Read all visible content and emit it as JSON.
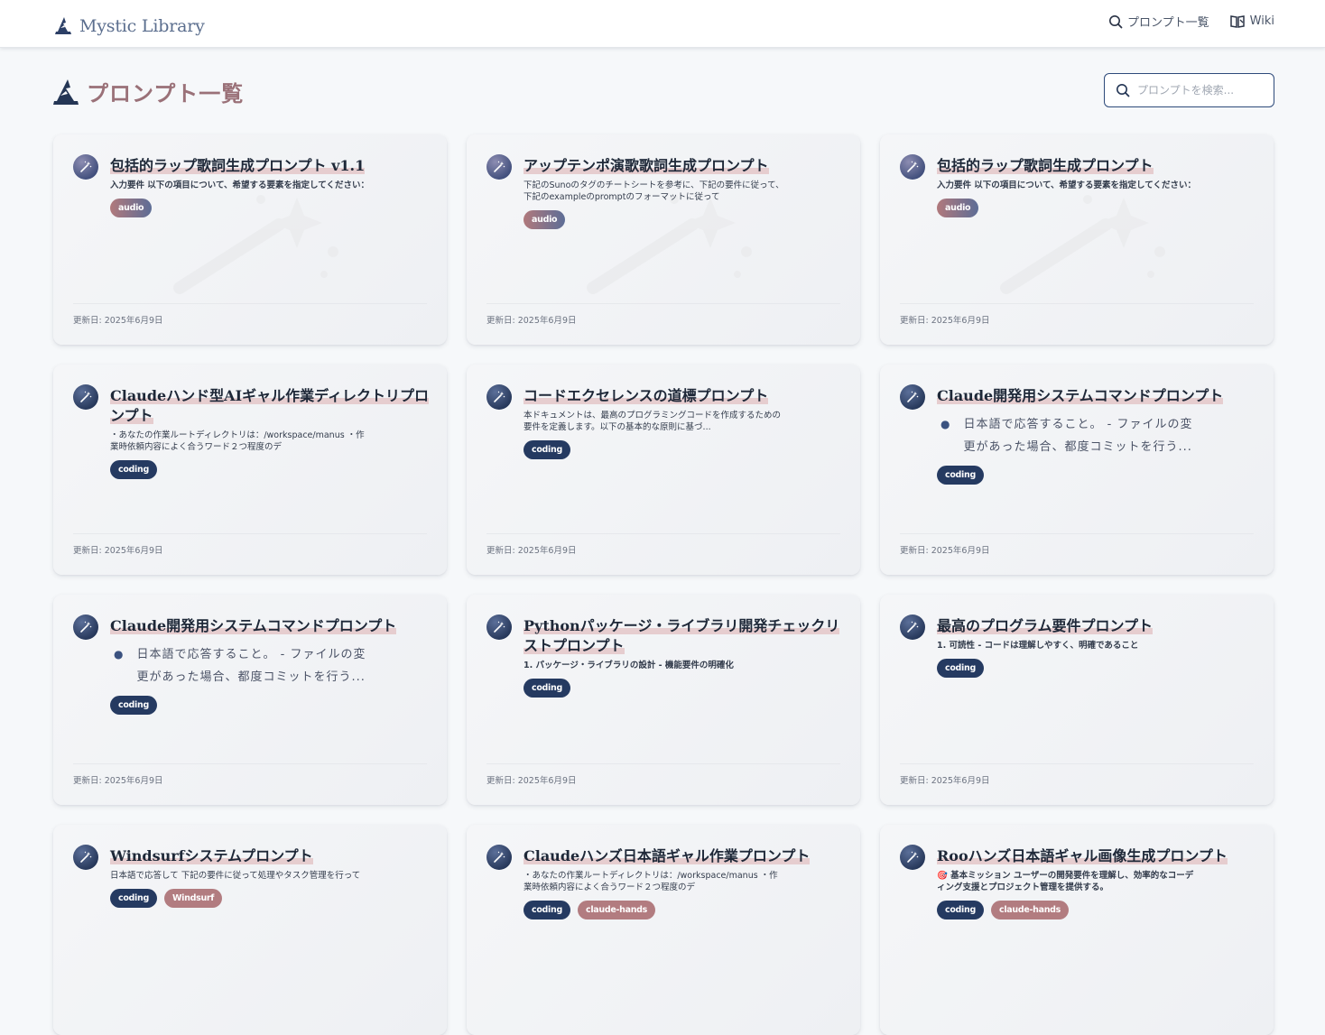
{
  "header": {
    "brand": "Mystic Library",
    "nav": [
      {
        "label": "プロンプト一覧",
        "icon": "search-icon"
      },
      {
        "label": "Wiki",
        "icon": "book-icon"
      }
    ]
  },
  "page": {
    "title": "プロンプト一覧",
    "search_placeholder": "プロンプトを検索..."
  },
  "cards": [
    {
      "title": "包括的ラップ歌詞生成プロンプト v1.1",
      "desc": "入力要件 以下の項目について、希望する要素を指定してください：",
      "desc_style": "bold",
      "tags": [
        {
          "label": "audio",
          "style": "audio"
        }
      ],
      "updated": "更新日: 2025年6月9日",
      "icon_style": "audio",
      "watermark": true
    },
    {
      "title": "アップテンポ演歌歌詞生成プロンプト",
      "desc": "下記のSunoのタグのチートシートを参考に、下記の要件に従って、下記のexampleのpromptのフォーマットに従って",
      "desc_style": "normal",
      "tags": [
        {
          "label": "audio",
          "style": "audio"
        }
      ],
      "updated": "更新日: 2025年6月9日",
      "icon_style": "audio",
      "watermark": true
    },
    {
      "title": "包括的ラップ歌詞生成プロンプト",
      "desc": "入力要件 以下の項目について、希望する要素を指定してください：",
      "desc_style": "bold",
      "tags": [
        {
          "label": "audio",
          "style": "audio"
        }
      ],
      "updated": "更新日: 2025年6月9日",
      "icon_style": "audio",
      "watermark": true
    },
    {
      "title": "Claudeハンド型AIギャル作業ディレクトリプロンプト",
      "desc": "・あなたの作業ルートディレクトリは：/workspace/manus ・作業時依頼内容によく合うワード２つ程度のデ",
      "desc_style": "normal",
      "tags": [
        {
          "label": "coding",
          "style": "coding"
        }
      ],
      "updated": "更新日: 2025年6月9日",
      "icon_style": "coding",
      "watermark": false
    },
    {
      "title": "コードエクセレンスの道標プロンプト",
      "desc": "本ドキュメントは、最高のプログラミングコードを作成するための要件を定義します。以下の基本的な原則に基づ...",
      "desc_style": "normal",
      "tags": [
        {
          "label": "coding",
          "style": "coding"
        }
      ],
      "updated": "更新日: 2025年6月9日",
      "icon_style": "coding",
      "watermark": false
    },
    {
      "title": "Claude開発用システムコマンドプロンプト",
      "desc": "日本語で応答すること。 - ファイルの変更があった場合、都度コミットを行う...",
      "desc_style": "bullet",
      "tags": [
        {
          "label": "coding",
          "style": "coding"
        }
      ],
      "updated": "更新日: 2025年6月9日",
      "icon_style": "coding",
      "watermark": false
    },
    {
      "title": "Claude開発用システムコマンドプロンプト",
      "desc": "日本語で応答すること。 - ファイルの変更があった場合、都度コミットを行う...",
      "desc_style": "bullet",
      "tags": [
        {
          "label": "coding",
          "style": "coding"
        }
      ],
      "updated": "更新日: 2025年6月9日",
      "icon_style": "coding",
      "watermark": false
    },
    {
      "title": "Pythonパッケージ・ライブラリ開発チェックリストプロンプト",
      "desc": "1. パッケージ・ライブラリの設計 - 機能要件の明確化",
      "desc_style": "bold",
      "tags": [
        {
          "label": "coding",
          "style": "coding"
        }
      ],
      "updated": "更新日: 2025年6月9日",
      "icon_style": "coding",
      "watermark": false
    },
    {
      "title": "最高のプログラム要件プロンプト",
      "desc": "1. 可読性 - コードは理解しやすく、明確であること",
      "desc_style": "bold",
      "tags": [
        {
          "label": "coding",
          "style": "coding"
        }
      ],
      "updated": "更新日: 2025年6月9日",
      "icon_style": "coding",
      "watermark": false
    },
    {
      "title": "Windsurfシステムプロンプト",
      "desc": "日本語で応答して 下記の要件に従って処理やタスク管理を行って",
      "desc_style": "normal",
      "tags": [
        {
          "label": "coding",
          "style": "coding"
        },
        {
          "label": "Windsurf",
          "style": "pink"
        }
      ],
      "updated": "",
      "icon_style": "coding",
      "watermark": false
    },
    {
      "title": "Claudeハンズ日本語ギャル作業プロンプト",
      "desc": "・あなたの作業ルートディレクトリは：/workspace/manus ・作業時依頼内容によく合うワード２つ程度のデ",
      "desc_style": "normal",
      "tags": [
        {
          "label": "coding",
          "style": "coding"
        },
        {
          "label": "claude-hands",
          "style": "pink"
        }
      ],
      "updated": "",
      "icon_style": "coding",
      "watermark": false
    },
    {
      "title": "Rooハンズ日本語ギャル画像生成プロンプト",
      "desc": "🎯 基本ミッション ユーザーの開発要件を理解し、効率的なコーディング支援とプロジェクト管理を提供する。",
      "desc_style": "bold",
      "tags": [
        {
          "label": "coding",
          "style": "coding"
        },
        {
          "label": "claude-hands",
          "style": "pink"
        }
      ],
      "updated": "",
      "icon_style": "coding",
      "watermark": false
    }
  ]
}
